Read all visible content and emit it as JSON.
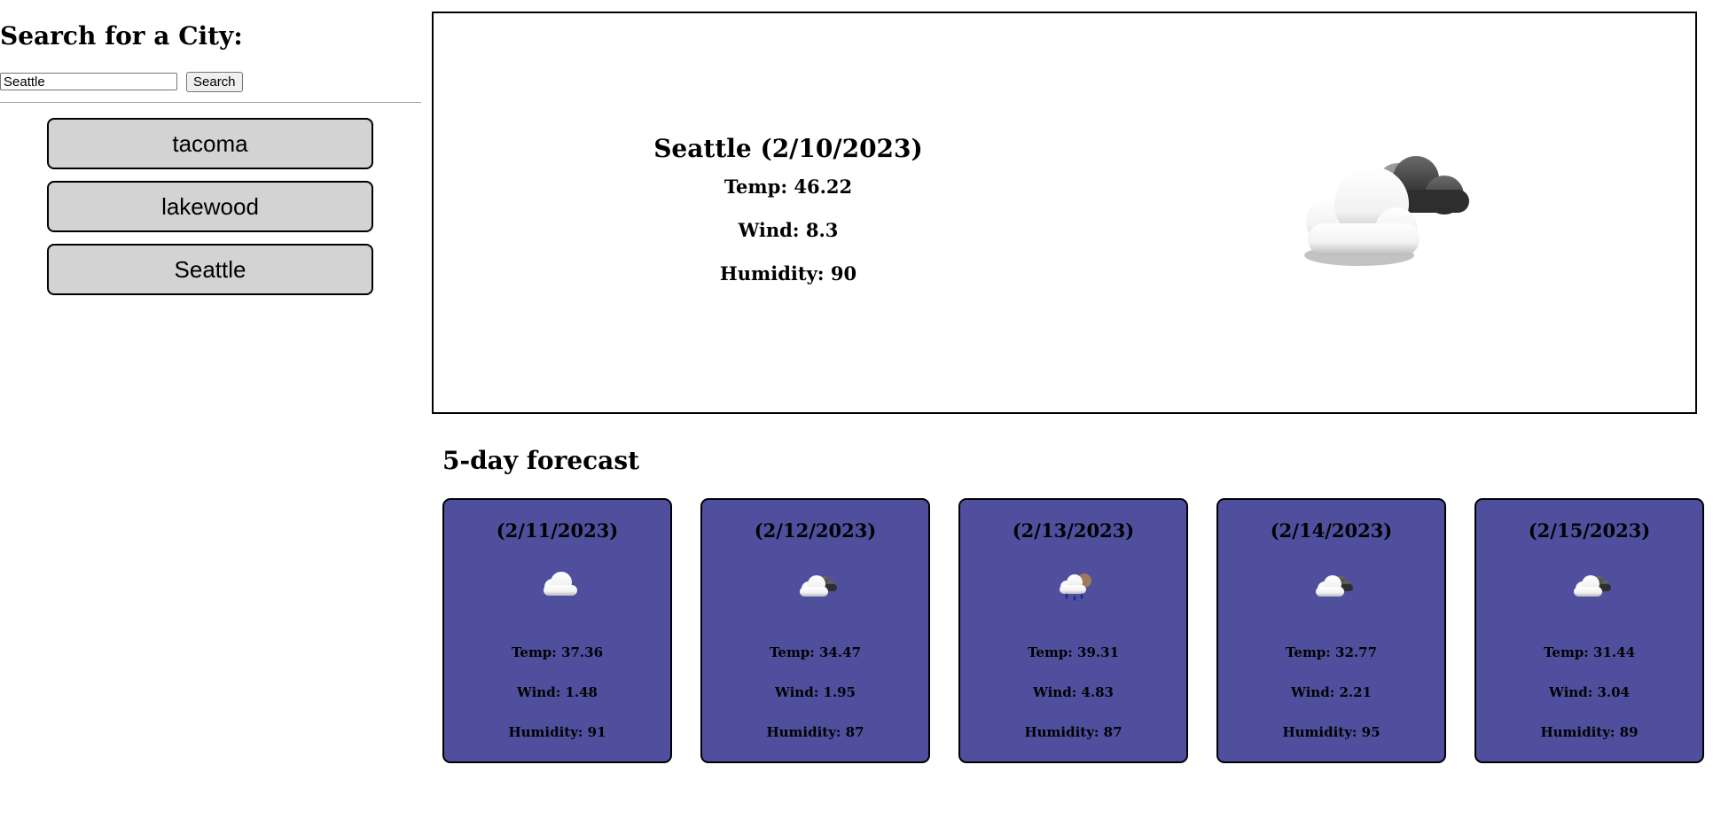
{
  "sidebar": {
    "heading": "Search for a City:",
    "search": {
      "value": "Seattle",
      "button_label": "Search"
    },
    "history": [
      "tacoma",
      "lakewood",
      "Seattle"
    ]
  },
  "current": {
    "title": "Seattle (2/10/2023)",
    "temp": "Temp: 46.22",
    "wind": "Wind: 8.3",
    "humidity": "Humidity: 90",
    "icon": "partly-cloudy-dark-icon"
  },
  "forecast": {
    "heading": "5-day forecast",
    "card_color": "#4f4f9e",
    "days": [
      {
        "date": "(2/11/2023)",
        "icon": "cloud-icon",
        "temp": "Temp: 37.36",
        "wind": "Wind: 1.48",
        "humidity": "Humidity: 91"
      },
      {
        "date": "(2/12/2023)",
        "icon": "broken-clouds-icon",
        "temp": "Temp: 34.47",
        "wind": "Wind: 1.95",
        "humidity": "Humidity: 87"
      },
      {
        "date": "(2/13/2023)",
        "icon": "rain-icon",
        "temp": "Temp: 39.31",
        "wind": "Wind: 4.83",
        "humidity": "Humidity: 87"
      },
      {
        "date": "(2/14/2023)",
        "icon": "broken-clouds-icon",
        "temp": "Temp: 32.77",
        "wind": "Wind: 2.21",
        "humidity": "Humidity: 95"
      },
      {
        "date": "(2/15/2023)",
        "icon": "broken-clouds-icon",
        "temp": "Temp: 31.44",
        "wind": "Wind: 3.04",
        "humidity": "Humidity: 89"
      }
    ]
  }
}
